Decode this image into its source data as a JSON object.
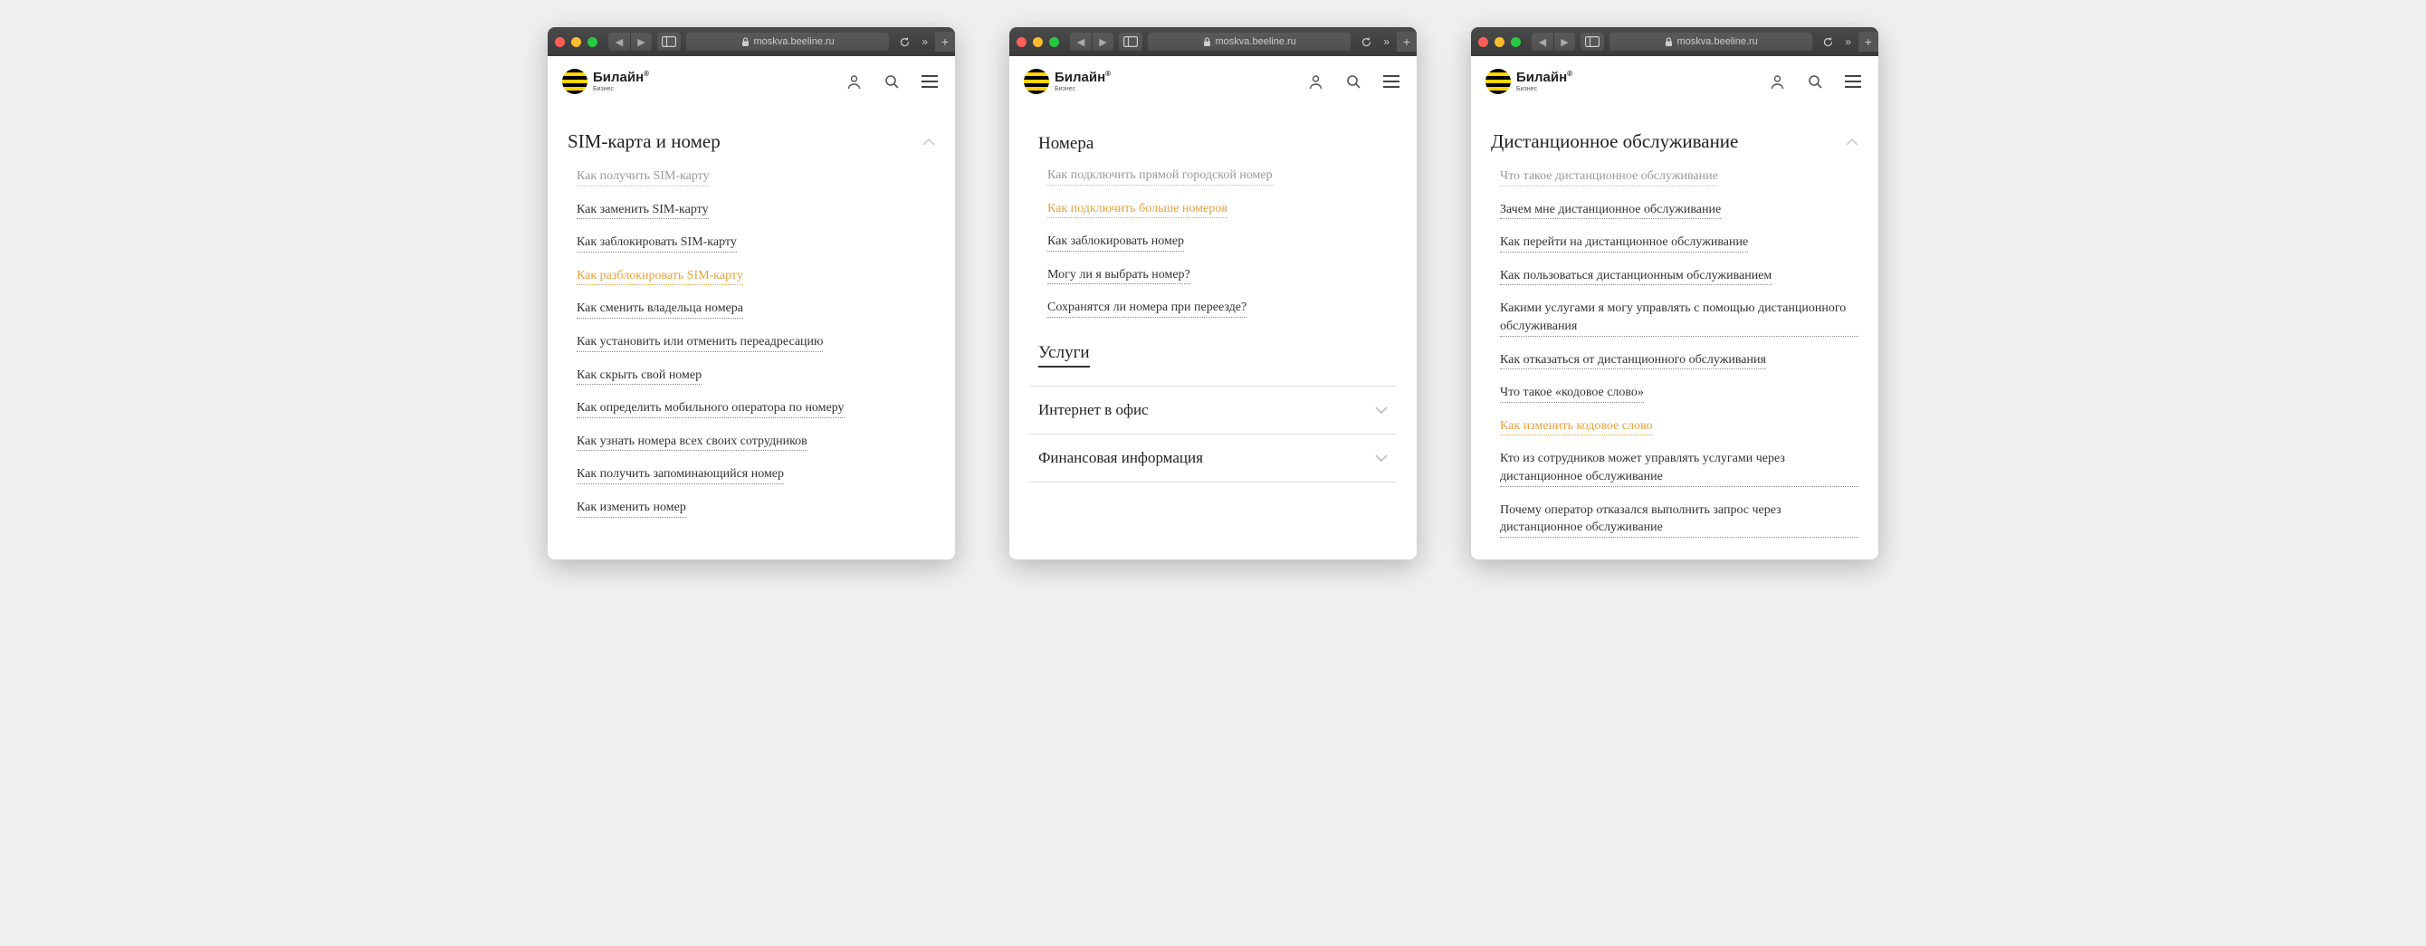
{
  "browser": {
    "url": "moskva.beeline.ru"
  },
  "header": {
    "brand": "Билайн",
    "sub": "Бизнес",
    "trademark": "®"
  },
  "windows": [
    {
      "title": "SIM-карта и номер",
      "links": [
        {
          "text": "Как получить SIM-карту",
          "state": "muted"
        },
        {
          "text": "Как заменить SIM-карту",
          "state": "normal"
        },
        {
          "text": "Как заблокировать SIM-карту",
          "state": "normal"
        },
        {
          "text": "Как разблокировать SIM-карту",
          "state": "highlight"
        },
        {
          "text": "Как сменить владельца номера",
          "state": "normal"
        },
        {
          "text": "Как установить или отменить переадресацию",
          "state": "normal"
        },
        {
          "text": "Как скрыть свой номер",
          "state": "normal"
        },
        {
          "text": "Как определить мобильного оператора по номеру",
          "state": "normal"
        },
        {
          "text": "Как узнать номера всех своих сотрудников",
          "state": "normal"
        },
        {
          "text": "Как получить запоминающийся номер",
          "state": "normal"
        },
        {
          "text": "Как изменить номер",
          "state": "normal"
        }
      ]
    },
    {
      "title": "Номера",
      "links": [
        {
          "text": "Как подключить прямой городской номер",
          "state": "muted"
        },
        {
          "text": "Как подключить больше номеров",
          "state": "highlight"
        },
        {
          "text": "Как заблокировать номер",
          "state": "normal"
        },
        {
          "text": "Могу ли я выбрать номер?",
          "state": "normal"
        },
        {
          "text": "Сохранятся ли номера при переезде?",
          "state": "normal"
        }
      ],
      "sub_section": "Услуги",
      "accordions": [
        "Интернет в офис",
        "Финансовая информация"
      ]
    },
    {
      "title": "Дистанционное обслуживание",
      "links": [
        {
          "text": "Что такое дистанционное обслуживание",
          "state": "muted"
        },
        {
          "text": "Зачем мне дистанционное обслуживание",
          "state": "normal"
        },
        {
          "text": "Как перейти на дистанционное обслуживание",
          "state": "normal"
        },
        {
          "text": "Как пользоваться дистанционным обслуживанием",
          "state": "normal"
        },
        {
          "text": "Какими услугами я могу управлять с помощью дистанционного обслуживания",
          "state": "normal"
        },
        {
          "text": "Как отказаться от дистанционного обслуживания",
          "state": "normal"
        },
        {
          "text": "Что такое «кодовое слово»",
          "state": "normal"
        },
        {
          "text": "Как изменить кодовое слово",
          "state": "highlight"
        },
        {
          "text": "Кто из сотрудников может управлять услугами через дистанционное обслуживание",
          "state": "normal"
        },
        {
          "text": "Почему оператор отказался выполнить запрос через дистанционное обслуживание",
          "state": "normal"
        }
      ]
    }
  ]
}
